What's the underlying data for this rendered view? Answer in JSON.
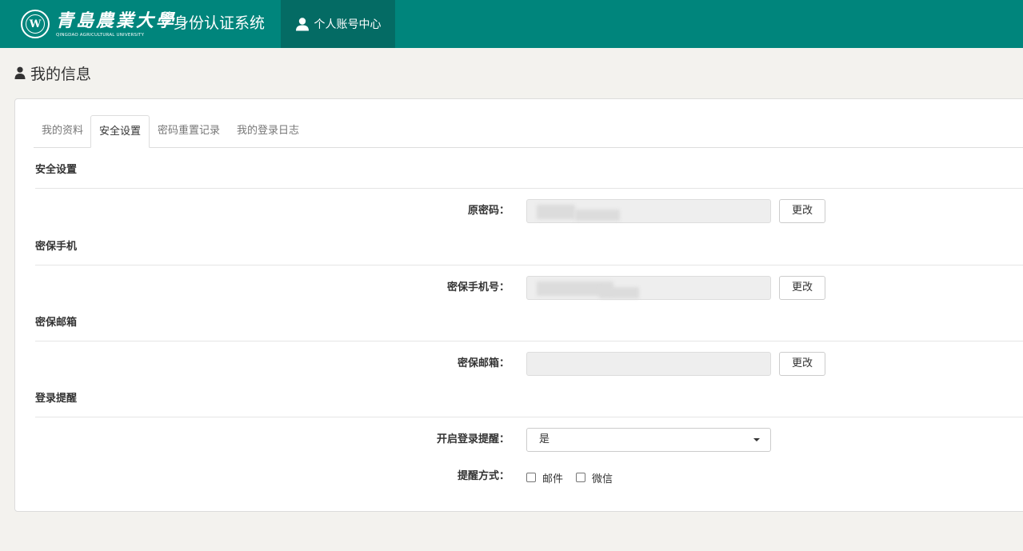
{
  "header": {
    "school_name_cn": "青島農業大學",
    "school_name_en": "QINGDAO AGRICULTURAL UNIVERSITY",
    "separator": "·",
    "system_title": "身份认证系统",
    "nav_account": "个人账号中心"
  },
  "page": {
    "heading": "我的信息"
  },
  "tabs": [
    {
      "label": "我的资料",
      "active": false
    },
    {
      "label": "安全设置",
      "active": true
    },
    {
      "label": "密码重置记录",
      "active": false
    },
    {
      "label": "我的登录日志",
      "active": false
    }
  ],
  "sections": {
    "security": {
      "title": "安全设置",
      "label": "原密码：",
      "value": "",
      "button": "更改"
    },
    "phone": {
      "title": "密保手机",
      "label": "密保手机号：",
      "value": "",
      "button": "更改"
    },
    "email": {
      "title": "密保邮箱",
      "label": "密保邮箱：",
      "value": "",
      "button": "更改"
    },
    "login_alert": {
      "title": "登录提醒",
      "enable_label": "开启登录提醒：",
      "enable_value": "是",
      "method_label": "提醒方式：",
      "methods": [
        {
          "label": "邮件",
          "checked": false
        },
        {
          "label": "微信",
          "checked": false
        }
      ]
    }
  },
  "colors": {
    "header_bg": "#00857c",
    "header_active_bg": "#046b64",
    "page_bg": "#f3f2ee"
  },
  "icons": {
    "logo": "university-seal-icon",
    "account": "user-icon",
    "heading": "user-icon",
    "select": "caret-down-icon"
  }
}
